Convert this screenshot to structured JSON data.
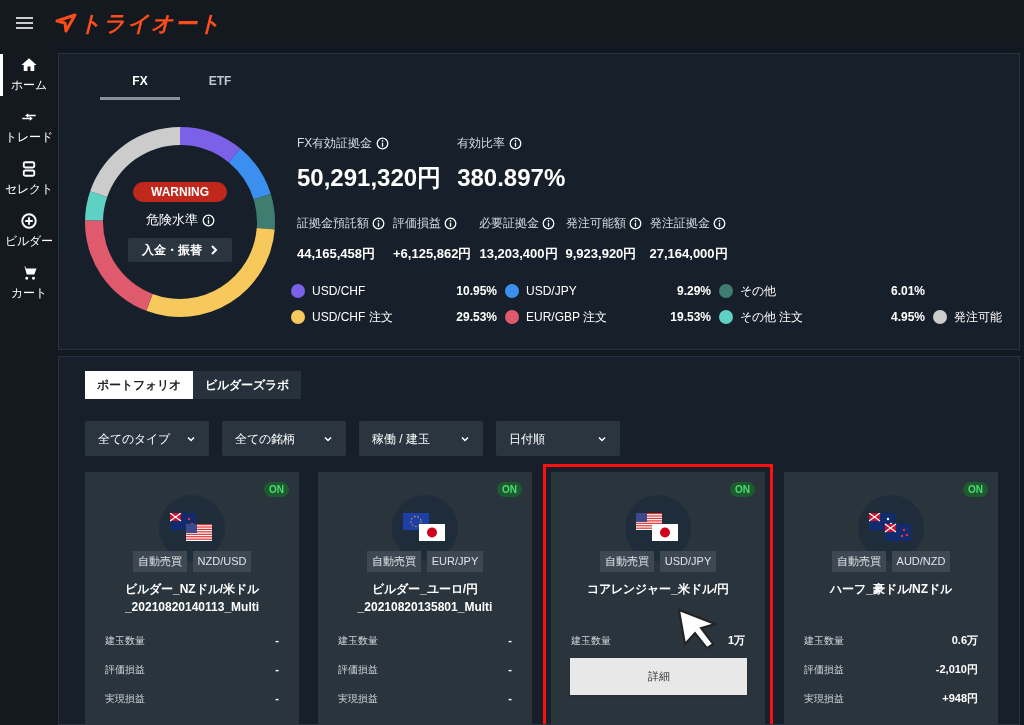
{
  "header": {
    "logo": "トライオート"
  },
  "sidebar": {
    "items": [
      {
        "label": "ホーム",
        "kind": "home",
        "selected": true
      },
      {
        "label": "トレード",
        "kind": "trade",
        "selected": false
      },
      {
        "label": "セレクト",
        "kind": "select",
        "selected": false
      },
      {
        "label": "ビルダー",
        "kind": "builder",
        "selected": false
      },
      {
        "label": "カート",
        "kind": "cart",
        "selected": false
      }
    ]
  },
  "summary": {
    "tabs": [
      {
        "label": "FX",
        "selected": true
      },
      {
        "label": "ETF",
        "selected": false
      }
    ],
    "status_badge": "WARNING",
    "status_label": "危険水準",
    "deposit_button": "入金・振替",
    "headline": [
      {
        "label": "FX有効証拠金",
        "value": "50,291,320円"
      },
      {
        "label": "有効比率",
        "value": "380.897%"
      }
    ],
    "metrics": [
      {
        "label": "証拠金預託額",
        "value": "44,165,458円"
      },
      {
        "label": "評価損益",
        "value": "+6,125,862円"
      },
      {
        "label": "必要証拠金",
        "value": "13,203,400円"
      },
      {
        "label": "発注可能額",
        "value": "9,923,920円"
      },
      {
        "label": "発注証拠金",
        "value": "27,164,000円"
      }
    ],
    "legend": [
      {
        "value": "10.95%",
        "color": "#7b61e8"
      },
      {
        "value": "9.29%",
        "color": "#3b8fef"
      },
      {
        "value": "6.01%",
        "color": "#3e7d70"
      },
      {
        "value": "29.53%",
        "color": "#f7c95c"
      },
      {
        "value": "19.53%",
        "color": "#e05a6e"
      },
      {
        "value": "4.95%",
        "color": "#5fd0c4"
      },
      {
        "color": "#cccccc"
      }
    ],
    "chart_data": {
      "type": "donut",
      "categories": [
        "USD/CHF",
        "USD/JPY",
        "その他",
        "USD/CHF 注文",
        "EUR/GBP 注文",
        "その他 注文",
        "発注可能"
      ],
      "values": [
        10.95,
        9.29,
        6.01,
        29.53,
        19.53,
        4.95,
        19.74
      ]
    }
  },
  "portfolio": {
    "tabs": [
      {
        "label": "ポートフォリオ",
        "selected": true
      },
      {
        "label": "ビルダーズラボ",
        "selected": false
      }
    ],
    "filters": [
      "全てのタイプ",
      "全ての銘柄",
      "稼働 / 建玉",
      "日付順"
    ],
    "cards": [
      {
        "status": "ON",
        "flags": [
          {
            "kind": "nz"
          },
          {
            "kind": "us"
          }
        ],
        "tags": [
          "自動売買",
          "NZD/USD"
        ],
        "title": "ビルダー_NZドル/米ドル\n_20210820140113_Multi",
        "highlighted": false,
        "rows": [
          {
            "label": "建玉数量",
            "value": "-"
          },
          {
            "label": "評価損益",
            "value": "-"
          },
          {
            "label": "実現損益",
            "value": "-"
          }
        ]
      },
      {
        "status": "ON",
        "flags": [
          {
            "kind": "eu"
          },
          {
            "kind": "jp"
          }
        ],
        "tags": [
          "自動売買",
          "EUR/JPY"
        ],
        "title": "ビルダー_ユーロ/円\n_20210820135801_Multi",
        "highlighted": false,
        "rows": [
          {
            "label": "建玉数量",
            "value": "-"
          },
          {
            "label": "評価損益",
            "value": "-"
          },
          {
            "label": "実現損益",
            "value": "-"
          }
        ]
      },
      {
        "status": "ON",
        "flags": [
          {
            "kind": "us"
          },
          {
            "kind": "jp"
          }
        ],
        "tags": [
          "自動売買",
          "USD/JPY"
        ],
        "title": "コアレンジャー_米ドル/円",
        "highlighted": true,
        "rows": [
          {
            "label": "建玉数量",
            "value": "1万"
          }
        ],
        "detail_button": "詳細"
      },
      {
        "status": "ON",
        "flags": [
          {
            "kind": "au"
          },
          {
            "kind": "nz"
          }
        ],
        "tags": [
          "自動売買",
          "AUD/NZD"
        ],
        "title": "ハーフ_豪ドル/NZドル",
        "highlighted": false,
        "rows": [
          {
            "label": "建玉数量",
            "value": "0.6万"
          },
          {
            "label": "評価損益",
            "value": "-2,010円"
          },
          {
            "label": "実現損益",
            "value": "+948円"
          }
        ]
      }
    ]
  }
}
